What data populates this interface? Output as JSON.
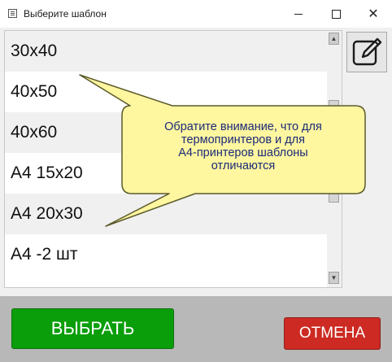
{
  "window": {
    "title": "Выберите шаблон"
  },
  "templates": {
    "items": [
      {
        "label": "30x40",
        "background": "#f0f0f0"
      },
      {
        "label": "40x50",
        "background": "#ffffff"
      },
      {
        "label": "40x60",
        "background": "#f0f0f0"
      },
      {
        "label": "A4 15x20",
        "background": "#ffffff"
      },
      {
        "label": "A4 20x30",
        "background": "#f0f0f0"
      },
      {
        "label": "A4 -2 шт",
        "background": "#ffffff"
      }
    ]
  },
  "tooltip": {
    "lines": [
      "Обратите внимание, что для",
      "термопринтеров и для",
      "А4-принтеров шаблоны",
      "отличаются"
    ],
    "background": "#fff6a0"
  },
  "actions": {
    "select_label": "ВЫБРАТЬ",
    "cancel_label": "ОТМЕНА",
    "select_color": "#0a9e0a",
    "cancel_color": "#cc2a22"
  },
  "icons": {
    "edit": "pencil-edit-icon"
  }
}
